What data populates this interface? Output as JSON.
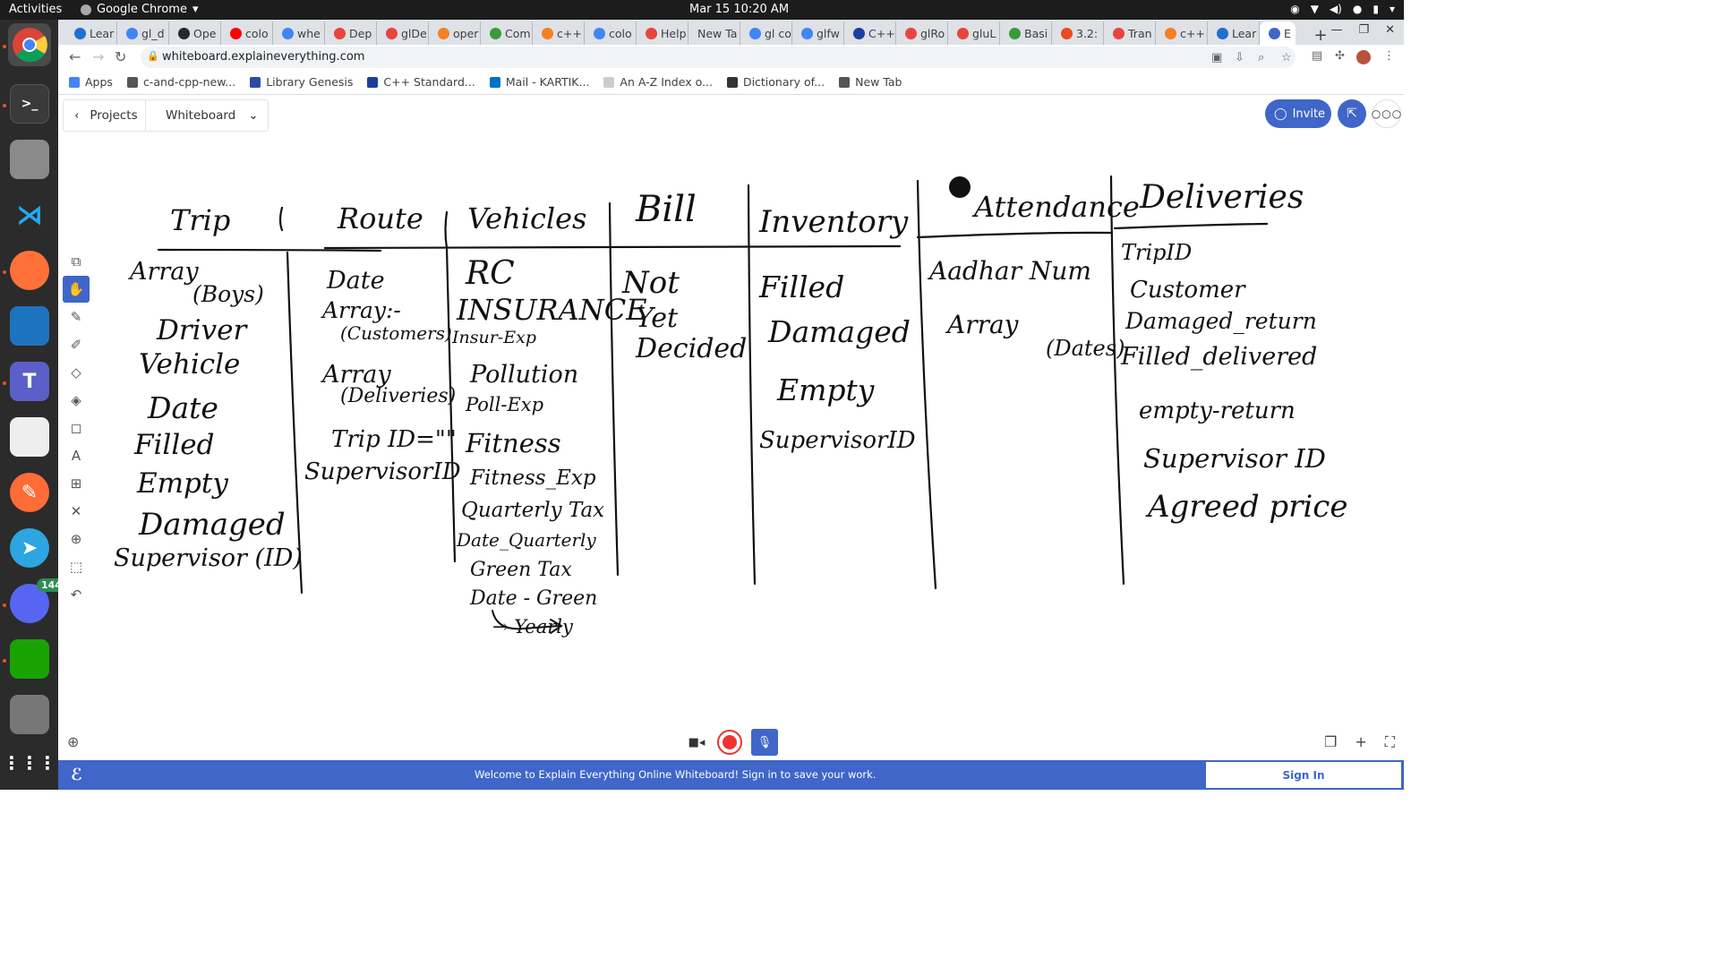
{
  "topbar": {
    "activities": "Activities",
    "app_name": "Google Chrome",
    "clock": "Mar 15  10:20 AM"
  },
  "dock": {
    "discord_badge": "144"
  },
  "tabs": [
    {
      "label": "Lear",
      "color": "#1f6fd1"
    },
    {
      "label": "gl_d",
      "color": "#4285f4"
    },
    {
      "label": "Ope",
      "color": "#24292e"
    },
    {
      "label": "colo",
      "color": "#ff0000"
    },
    {
      "label": "whe",
      "color": "#4285f4"
    },
    {
      "label": "Dep",
      "color": "#e8453c"
    },
    {
      "label": "glDe",
      "color": "#e8453c"
    },
    {
      "label": "oper",
      "color": "#f48024"
    },
    {
      "label": "Com",
      "color": "#3a9a3a"
    },
    {
      "label": "c++",
      "color": "#f48024"
    },
    {
      "label": "colo",
      "color": "#4285f4"
    },
    {
      "label": "Help",
      "color": "#e8453c"
    },
    {
      "label": "New Ta",
      "color": ""
    },
    {
      "label": "gl co",
      "color": "#4285f4"
    },
    {
      "label": "glfw",
      "color": "#4285f4"
    },
    {
      "label": "C++",
      "color": "#1a3fa0"
    },
    {
      "label": "glRo",
      "color": "#e8453c"
    },
    {
      "label": "gluL",
      "color": "#e8453c"
    },
    {
      "label": "Basi",
      "color": "#3a9a3a"
    },
    {
      "label": "3.2:",
      "color": "#e94b1b"
    },
    {
      "label": "Tran",
      "color": "#e8453c"
    },
    {
      "label": "c++",
      "color": "#f48024"
    },
    {
      "label": "Lear",
      "color": "#1f6fd1"
    },
    {
      "label": "E",
      "color": "#3f66c8"
    }
  ],
  "address_bar": {
    "url": "whiteboard.explaineverything.com"
  },
  "bookmarks": [
    {
      "label": "Apps",
      "color": "#4285f4"
    },
    {
      "label": "c-and-cpp-new...",
      "color": "#555555"
    },
    {
      "label": "Library Genesis",
      "color": "#2b4aa8"
    },
    {
      "label": "C++ Standard...",
      "color": "#1a3fa0"
    },
    {
      "label": "Mail - KARTIK...",
      "color": "#0072c6"
    },
    {
      "label": "An A-Z Index o...",
      "color": "#cccccc"
    },
    {
      "label": "Dictionary of...",
      "color": "#333333"
    },
    {
      "label": "New Tab",
      "color": "#555555"
    }
  ],
  "app": {
    "projects": "Projects",
    "board_name": "Whiteboard",
    "invite": "Invite",
    "banner": "Welcome to Explain Everything Online Whiteboard! Sign in to save your work.",
    "sign_in": "Sign In",
    "accent": "#3f66c8"
  },
  "whiteboard": {
    "columns": [
      {
        "heading": "Trip",
        "items": [
          "Array",
          "(Boys)",
          "Driver",
          "Vehicle",
          "Date",
          "Filled",
          "Empty",
          "Damaged",
          "Supervisor (ID)"
        ]
      },
      {
        "heading": "Route",
        "items": [
          "Date",
          "Array:-",
          "(Customers)",
          "Array",
          "(Deliveries)",
          "Trip ID=\"\"",
          "SupervisorID"
        ]
      },
      {
        "heading": "Vehicles",
        "items": [
          "RC",
          "INSURANCE",
          "Insur-Exp",
          "Pollution",
          "Poll-Exp",
          "Fitness",
          "Fitness_Exp",
          "Quarterly Tax",
          "Date_Quarterly",
          "Green Tax",
          "Date - Green",
          "→ Yearly"
        ]
      },
      {
        "heading": "Bill",
        "items": [
          "Not",
          "Yet",
          "Decided"
        ]
      },
      {
        "heading": "Inventory",
        "items": [
          "Filled",
          "Damaged",
          "Empty",
          "SupervisorID"
        ]
      },
      {
        "heading": "Attendance",
        "items": [
          "Aadhar Num",
          "Array",
          "(Dates)"
        ]
      },
      {
        "heading": "Deliveries",
        "items": [
          "TripID",
          "Customer",
          "Damaged_return",
          "Filled_delivered",
          "empty-return",
          "Supervisor ID",
          "Agreed price"
        ]
      }
    ]
  }
}
